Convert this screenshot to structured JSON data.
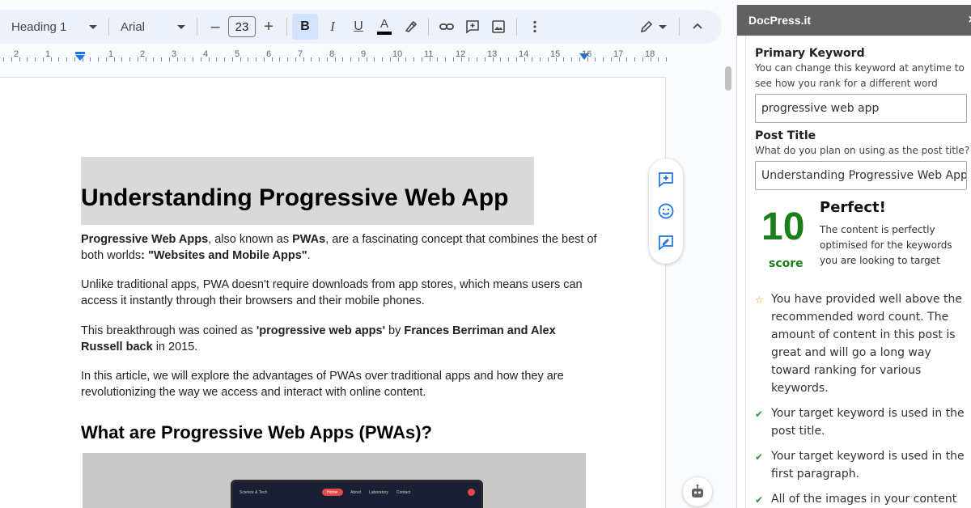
{
  "toolbar": {
    "style": "Heading 1",
    "font": "Arial",
    "font_size": "23",
    "minus": "–",
    "plus": "+",
    "bold": "B",
    "italic": "I",
    "underline": "U",
    "text_color": "A"
  },
  "ruler": {
    "numbers": [
      "2",
      "1",
      "1",
      "2",
      "3",
      "4",
      "5",
      "6",
      "7",
      "8",
      "9",
      "10",
      "11",
      "12",
      "13",
      "14",
      "15",
      "16",
      "17",
      "18"
    ]
  },
  "document": {
    "title": "Understanding Progressive Web App",
    "p1": {
      "b1": "Progressive Web Apps",
      "t1": ", also known as ",
      "b2": "PWAs",
      "t2": ", are a fascinating concept that combines the best of both worlds",
      "b3": ": \"Websites and Mobile Apps\"",
      "t3": "."
    },
    "p2": "Unlike traditional apps, PWA doesn't require downloads from app stores, which means users can access it instantly through their browsers and their mobile phones.",
    "p3": {
      "t1": "This breakthrough was coined as ",
      "b1": "'progressive web apps'",
      "t2": " by ",
      "b2": "Frances Berriman and Alex Russell back",
      "t3": " in 2015."
    },
    "p4": "In this article, we will explore the advantages of PWAs over traditional apps and how they are revolutionizing the way we access and interact with online content.",
    "h2": "What are Progressive Web Apps (PWAs)?",
    "image_nav": {
      "brand": "Science & Tech",
      "home": "Home",
      "about": "About",
      "lab": "Laboratory",
      "contact": "Contact"
    }
  },
  "sidebar": {
    "title": "DocPress.it",
    "close": "×",
    "primary_keyword_label": "Primary Keyword",
    "primary_keyword_hint": "You can change this keyword at anytime to see how you rank for a different word",
    "primary_keyword_value": "progressive web app",
    "post_title_label": "Post Title",
    "post_title_hint": "What do you plan on using as the post title?",
    "post_title_value": "Understanding Progressive Web App",
    "score": "10",
    "score_label": "score",
    "verdict": "Perfect!",
    "verdict_desc": "The content is perfectly optimised for the keywords you are looking to target",
    "checks": [
      {
        "icon": "star",
        "text": "You have provided well above the recommended word count. The amount of content in this post is great and will go a long way toward ranking for various keywords."
      },
      {
        "icon": "check",
        "text": "Your target keyword is used in the post title."
      },
      {
        "icon": "check",
        "text": "Your target keyword is used in the first paragraph."
      },
      {
        "icon": "check",
        "text": "All of the images in your content contain alt tags"
      }
    ]
  },
  "colors": {
    "score_green": "#1a7f1a",
    "sidebar_header": "#616161",
    "toolbar_bg": "#edf2fa",
    "bold_active": "#d3e3fd"
  }
}
